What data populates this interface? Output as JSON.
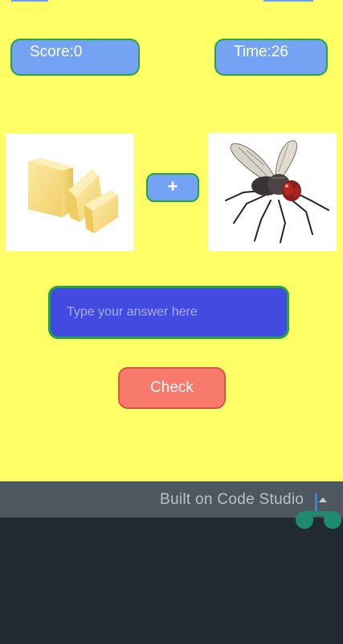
{
  "header": {
    "score_label": "Score:0",
    "time_label": "Time:26"
  },
  "puzzle": {
    "left_image": "butter",
    "operator": "+",
    "right_image": "fly"
  },
  "answer": {
    "placeholder": "Type your answer here",
    "value": ""
  },
  "actions": {
    "check_label": "Check"
  },
  "footer": {
    "built_on": "Built on Code Studio",
    "arrow_icon": "caret-up-icon"
  },
  "colors": {
    "background": "#ffff66",
    "pill": "#74a3f4",
    "border_green": "#22a44a",
    "input_bg": "#434ae0",
    "check_bg": "#f87a6c",
    "footer_bg": "#4d5760",
    "screen_bg": "#212a33",
    "logo_teal": "#1e8a6e"
  }
}
